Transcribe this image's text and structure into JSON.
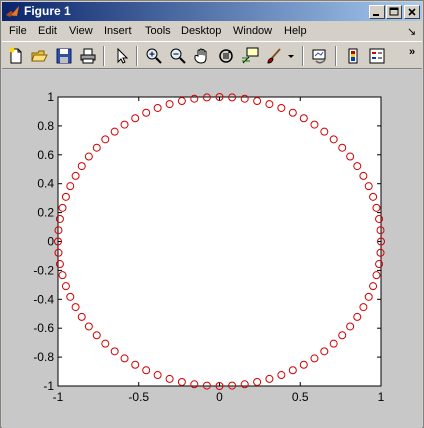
{
  "window": {
    "title": "Figure 1",
    "controls": [
      "minimize",
      "maximize",
      "close"
    ]
  },
  "menubar": {
    "items": [
      "File",
      "Edit",
      "View",
      "Insert",
      "Tools",
      "Desktop",
      "Window",
      "Help"
    ],
    "overflow_arrow": "↘"
  },
  "toolbar": {
    "icons": [
      "new-figure-icon",
      "open-file-icon",
      "save-icon",
      "print-icon",
      "pointer-icon",
      "zoom-in-icon",
      "zoom-out-icon",
      "pan-hand-icon",
      "rotate-3d-icon",
      "data-cursor-icon",
      "brush-icon",
      "brush-dropdown-icon",
      "link-plot-icon",
      "colorbar-icon",
      "legend-icon"
    ],
    "overflow": "»"
  },
  "colors": {
    "marker": "#d40000",
    "titlebar_start": "#0a246a",
    "titlebar_end": "#a6caf0",
    "window_bg": "#d4d0c8",
    "figure_bg": "#c8c8c8",
    "axes_bg": "#ffffff"
  },
  "chart_data": {
    "type": "scatter",
    "title": "",
    "xlabel": "",
    "ylabel": "",
    "xlim": [
      -1,
      1
    ],
    "ylim": [
      -1,
      1
    ],
    "xticks": [
      "-1",
      "-0.5",
      "0",
      "0.5",
      "1"
    ],
    "yticks": [
      "-1",
      "-0.8",
      "-0.6",
      "-0.4",
      "-0.2",
      "0",
      "0.2",
      "0.4",
      "0.6",
      "0.8",
      "1"
    ],
    "grid": false,
    "legend": "none",
    "marker": "circle (o), red, unfilled",
    "series": [
      {
        "description": "points on the unit circle x=cos(t), y=sin(t), t from 0 to 2π",
        "x": [
          1,
          0.997,
          0.988,
          0.972,
          0.951,
          0.924,
          0.891,
          0.853,
          0.809,
          0.76,
          0.707,
          0.649,
          0.588,
          0.522,
          0.454,
          0.383,
          0.309,
          0.233,
          0.156,
          0.078,
          0,
          -0.078,
          -0.156,
          -0.233,
          -0.309,
          -0.383,
          -0.454,
          -0.522,
          -0.588,
          -0.649,
          -0.707,
          -0.76,
          -0.809,
          -0.853,
          -0.891,
          -0.924,
          -0.951,
          -0.972,
          -0.988,
          -0.997,
          -1,
          -0.997,
          -0.988,
          -0.972,
          -0.951,
          -0.924,
          -0.891,
          -0.853,
          -0.809,
          -0.76,
          -0.707,
          -0.649,
          -0.588,
          -0.522,
          -0.454,
          -0.383,
          -0.309,
          -0.233,
          -0.156,
          -0.078,
          0,
          0.078,
          0.156,
          0.233,
          0.309,
          0.383,
          0.454,
          0.522,
          0.588,
          0.649,
          0.707,
          0.76,
          0.809,
          0.853,
          0.891,
          0.924,
          0.951,
          0.972,
          0.988,
          0.997
        ],
        "y": [
          0,
          0.078,
          0.156,
          0.233,
          0.309,
          0.383,
          0.454,
          0.522,
          0.588,
          0.649,
          0.707,
          0.76,
          0.809,
          0.853,
          0.891,
          0.924,
          0.951,
          0.972,
          0.988,
          0.997,
          1,
          0.997,
          0.988,
          0.972,
          0.951,
          0.924,
          0.891,
          0.853,
          0.809,
          0.76,
          0.707,
          0.649,
          0.588,
          0.522,
          0.454,
          0.383,
          0.309,
          0.233,
          0.156,
          0.078,
          0,
          -0.078,
          -0.156,
          -0.233,
          -0.309,
          -0.383,
          -0.454,
          -0.522,
          -0.588,
          -0.649,
          -0.707,
          -0.76,
          -0.809,
          -0.853,
          -0.891,
          -0.924,
          -0.951,
          -0.972,
          -0.988,
          -0.997,
          -1,
          -0.997,
          -0.988,
          -0.972,
          -0.951,
          -0.924,
          -0.891,
          -0.853,
          -0.809,
          -0.76,
          -0.707,
          -0.649,
          -0.588,
          -0.522,
          -0.454,
          -0.383,
          -0.309,
          -0.233,
          -0.156,
          -0.078
        ]
      }
    ]
  }
}
